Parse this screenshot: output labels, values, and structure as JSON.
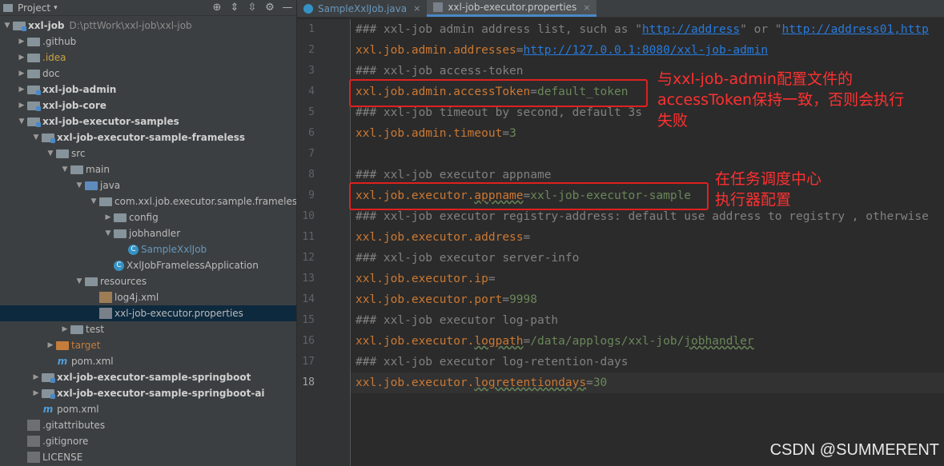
{
  "sidebar": {
    "title": "Project",
    "tree": [
      {
        "label": "xxl-job",
        "path": "D:\\pttWork\\xxl-job\\xxl-job",
        "depth": 0,
        "arrow": "down",
        "icon": "module-folder-icon",
        "bold": true
      },
      {
        "label": ".github",
        "depth": 1,
        "arrow": "right",
        "icon": "folder-icon"
      },
      {
        "label": ".idea",
        "depth": 1,
        "arrow": "right",
        "icon": "folder-icon",
        "color": "yellow"
      },
      {
        "label": "doc",
        "depth": 1,
        "arrow": "right",
        "icon": "folder-icon"
      },
      {
        "label": "xxl-job-admin",
        "depth": 1,
        "arrow": "right",
        "icon": "module-folder-icon",
        "bold": true
      },
      {
        "label": "xxl-job-core",
        "depth": 1,
        "arrow": "right",
        "icon": "module-folder-icon",
        "bold": true
      },
      {
        "label": "xxl-job-executor-samples",
        "depth": 1,
        "arrow": "down",
        "icon": "module-folder-icon",
        "bold": true
      },
      {
        "label": "xxl-job-executor-sample-frameless",
        "depth": 2,
        "arrow": "down",
        "icon": "module-folder-icon",
        "bold": true
      },
      {
        "label": "src",
        "depth": 3,
        "arrow": "down",
        "icon": "folder-icon"
      },
      {
        "label": "main",
        "depth": 4,
        "arrow": "down",
        "icon": "folder-icon"
      },
      {
        "label": "java",
        "depth": 5,
        "arrow": "down",
        "icon": "source-folder-icon"
      },
      {
        "label": "com.xxl.job.executor.sample.frameless",
        "depth": 6,
        "arrow": "down",
        "icon": "package-icon"
      },
      {
        "label": "config",
        "depth": 7,
        "arrow": "right",
        "icon": "package-icon"
      },
      {
        "label": "jobhandler",
        "depth": 7,
        "arrow": "down",
        "icon": "package-icon"
      },
      {
        "label": "SampleXxlJob",
        "depth": 8,
        "arrow": "",
        "icon": "class-icon",
        "color": "blue"
      },
      {
        "label": "XxlJobFramelessApplication",
        "depth": 7,
        "arrow": "",
        "icon": "class-icon"
      },
      {
        "label": "resources",
        "depth": 5,
        "arrow": "down",
        "icon": "resources-folder-icon"
      },
      {
        "label": "log4j.xml",
        "depth": 6,
        "arrow": "",
        "icon": "xml-file-icon"
      },
      {
        "label": "xxl-job-executor.properties",
        "depth": 6,
        "arrow": "",
        "icon": "properties-file-icon",
        "selected": true
      },
      {
        "label": "test",
        "depth": 4,
        "arrow": "right",
        "icon": "folder-icon"
      },
      {
        "label": "target",
        "depth": 3,
        "arrow": "right",
        "icon": "excluded-folder-icon",
        "color": "orange"
      },
      {
        "label": "pom.xml",
        "depth": 3,
        "arrow": "",
        "icon": "maven-file-icon"
      },
      {
        "label": "xxl-job-executor-sample-springboot",
        "depth": 2,
        "arrow": "right",
        "icon": "module-folder-icon",
        "bold": true
      },
      {
        "label": "xxl-job-executor-sample-springboot-ai",
        "depth": 2,
        "arrow": "right",
        "icon": "module-folder-icon",
        "bold": true
      },
      {
        "label": "pom.xml",
        "depth": 2,
        "arrow": "",
        "icon": "maven-file-icon"
      },
      {
        "label": ".gitattributes",
        "depth": 1,
        "arrow": "",
        "icon": "git-file-icon"
      },
      {
        "label": ".gitignore",
        "depth": 1,
        "arrow": "",
        "icon": "git-file-icon"
      },
      {
        "label": "LICENSE",
        "depth": 1,
        "arrow": "",
        "icon": "text-file-icon"
      }
    ]
  },
  "tabs": [
    {
      "label": "SampleXxlJob.java",
      "active": false,
      "icon": "class-icon"
    },
    {
      "label": "xxl-job-executor.properties",
      "active": true,
      "icon": "properties-file-icon"
    }
  ],
  "editor": {
    "current_line": 18,
    "lines": [
      [
        {
          "t": "### xxl-job admin address list, such as \"",
          "c": "cmt"
        },
        {
          "t": "http://address",
          "c": "url"
        },
        {
          "t": "\" or \"",
          "c": "cmt"
        },
        {
          "t": "http://address01,http",
          "c": "url"
        }
      ],
      [
        {
          "t": "xxl.job.admin.addresses",
          "c": "key"
        },
        {
          "t": "=",
          "c": "eq"
        },
        {
          "t": "http://127.0.0.1:8080/xxl-job-admin",
          "c": "url"
        }
      ],
      [
        {
          "t": "### xxl-job access-token",
          "c": "cmt"
        }
      ],
      [
        {
          "t": "xxl.job.admin.accessToken",
          "c": "key"
        },
        {
          "t": "=",
          "c": "eq"
        },
        {
          "t": "default_token",
          "c": "val"
        }
      ],
      [
        {
          "t": "### xxl-job timeout by second, default 3s",
          "c": "cmt"
        }
      ],
      [
        {
          "t": "xxl.job.admin.timeout",
          "c": "key"
        },
        {
          "t": "=",
          "c": "eq"
        },
        {
          "t": "3",
          "c": "val"
        }
      ],
      [],
      [
        {
          "t": "### xxl-job executor appname",
          "c": "cmt"
        }
      ],
      [
        {
          "t": "xxl.job.executor.",
          "c": "key"
        },
        {
          "t": "appname",
          "c": "key squig"
        },
        {
          "t": "=",
          "c": "eq"
        },
        {
          "t": "xxl-job-executor-sample",
          "c": "val"
        }
      ],
      [
        {
          "t": "### xxl-job executor registry-address: default use address to registry , otherwise",
          "c": "cmt"
        }
      ],
      [
        {
          "t": "xxl.job.executor.address",
          "c": "key"
        },
        {
          "t": "=",
          "c": "eq"
        }
      ],
      [
        {
          "t": "### xxl-job executor server-info",
          "c": "cmt"
        }
      ],
      [
        {
          "t": "xxl.job.executor.ip",
          "c": "key"
        },
        {
          "t": "=",
          "c": "eq"
        }
      ],
      [
        {
          "t": "xxl.job.executor.port",
          "c": "key"
        },
        {
          "t": "=",
          "c": "eq"
        },
        {
          "t": "9998",
          "c": "val"
        }
      ],
      [
        {
          "t": "### xxl-job executor log-path",
          "c": "cmt"
        }
      ],
      [
        {
          "t": "xxl.job.executor.",
          "c": "key"
        },
        {
          "t": "logpath",
          "c": "key squig"
        },
        {
          "t": "=",
          "c": "eq"
        },
        {
          "t": "/data/applogs/xxl-job/",
          "c": "val"
        },
        {
          "t": "jobhandler",
          "c": "val squig"
        }
      ],
      [
        {
          "t": "### xxl-job executor log-retention-days",
          "c": "cmt"
        }
      ],
      [
        {
          "t": "xxl.job.executor.",
          "c": "key"
        },
        {
          "t": "logretentiondays",
          "c": "key squig"
        },
        {
          "t": "=",
          "c": "eq"
        },
        {
          "t": "30",
          "c": "val"
        }
      ]
    ]
  },
  "annotations": {
    "note1": "与xxl-job-admin配置文件的\naccessToken保持一致，否则会执行\n失败",
    "note2": "在任务调度中心\n执行器配置"
  },
  "watermark": "CSDN @SUMMERENT",
  "colors": {
    "annotation_red": "#e02020",
    "accent": "#4a88c7"
  }
}
